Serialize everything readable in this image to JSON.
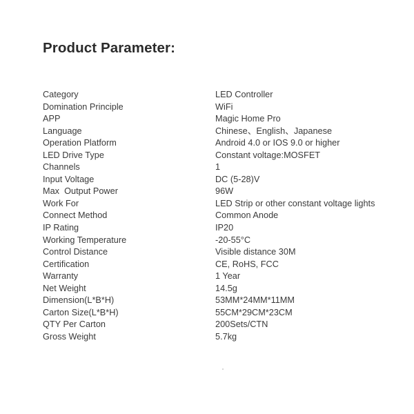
{
  "document": {
    "title": "Product Parameter:",
    "footer_mark": "."
  },
  "spec_table": {
    "rows": [
      {
        "label": "Category",
        "value": "LED Controller"
      },
      {
        "label": "Domination Principle",
        "value": "WiFi"
      },
      {
        "label": "APP",
        "value": "Magic Home Pro"
      },
      {
        "label": "Language",
        "value": "Chinese、English、Japanese"
      },
      {
        "label": "Operation Platform",
        "value": "Android 4.0 or IOS 9.0 or higher"
      },
      {
        "label": "LED Drive Type",
        "value": "Constant voltage:MOSFET"
      },
      {
        "label": "Channels",
        "value": "1"
      },
      {
        "label": "Input Voltage",
        "value": "DC (5-28)V"
      },
      {
        "label": "Max  Output Power",
        "value": "96W"
      },
      {
        "label": "Work For",
        "value": "LED Strip or other constant voltage lights"
      },
      {
        "label": "Connect Method",
        "value": "Common Anode"
      },
      {
        "label": "IP Rating",
        "value": "IP20"
      },
      {
        "label": "Working Temperature",
        "value": "-20-55°C"
      },
      {
        "label": "Control Distance",
        "value": "Visible distance 30M"
      },
      {
        "label": "Certification",
        "value": "CE, RoHS, FCC"
      },
      {
        "label": "Warranty",
        "value": "1 Year"
      },
      {
        "label": "Net Weight",
        "value": "14.5g"
      },
      {
        "label": "Dimension(L*B*H)",
        "value": "53MM*24MM*11MM"
      },
      {
        "label": "Carton Size(L*B*H)",
        "value": "55CM*29CM*23CM"
      },
      {
        "label": "QTY Per Carton",
        "value": "200Sets/CTN"
      },
      {
        "label": "Gross Weight",
        "value": "5.7kg"
      }
    ]
  },
  "colors": {
    "background": "#ffffff",
    "title_text": "#2b2b2b",
    "body_text": "#3a3a3a"
  }
}
